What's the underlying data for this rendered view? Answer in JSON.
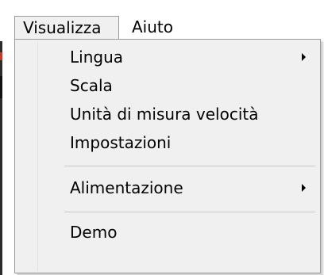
{
  "menubar": {
    "items": [
      {
        "label": "Visualizza",
        "open": true
      },
      {
        "label": "Aiuto",
        "open": false
      }
    ]
  },
  "dropdown": {
    "items": [
      {
        "label": "Lingua",
        "submenu": true
      },
      {
        "label": "Scala",
        "submenu": false
      },
      {
        "label": "Unità di misura velocità",
        "submenu": false
      },
      {
        "label": "Impostazioni",
        "submenu": false
      },
      {
        "label": "Alimentazione",
        "submenu": true
      },
      {
        "label": "Demo",
        "submenu": false
      }
    ]
  },
  "colors": {
    "menu_background": "#f0f0f0",
    "border": "#9a9a9a",
    "separator": "#c8c8c8",
    "text": "#000000"
  },
  "icons": {
    "submenu_arrow": "chevron-right-icon"
  }
}
